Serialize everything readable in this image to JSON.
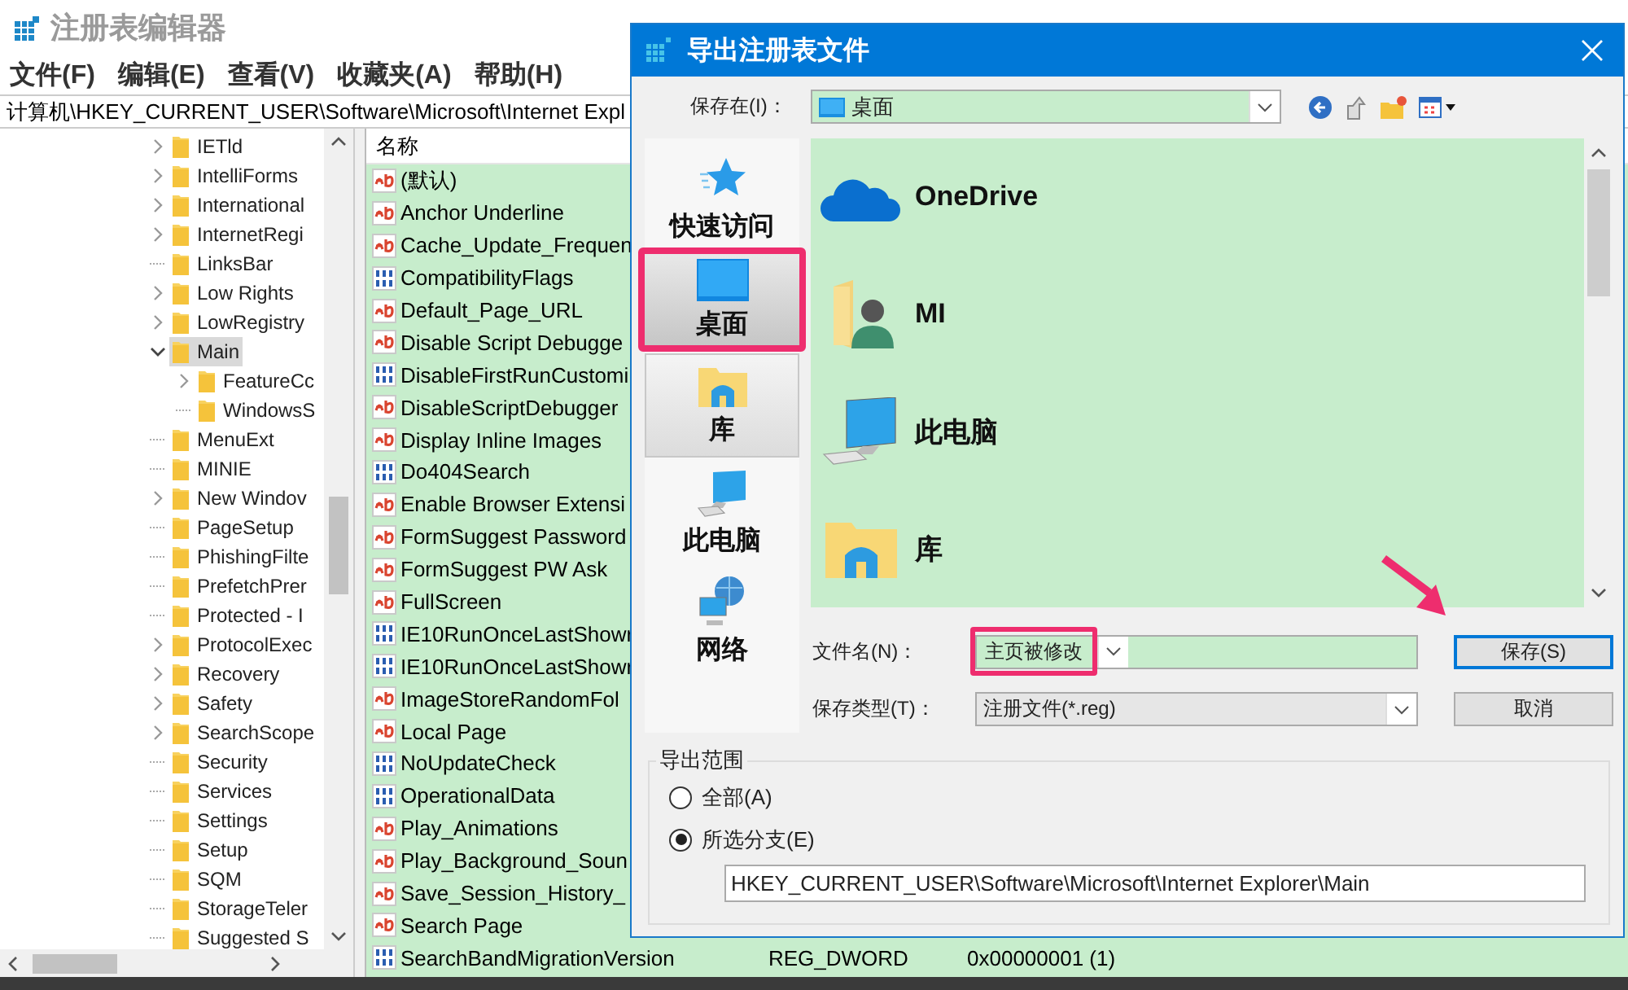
{
  "registry_window": {
    "title": "注册表编辑器",
    "menu": [
      "文件(F)",
      "编辑(E)",
      "查看(V)",
      "收藏夹(A)",
      "帮助(H)"
    ],
    "address": "计算机\\HKEY_CURRENT_USER\\Software\\Microsoft\\Internet Expl",
    "tree": [
      {
        "label": "IETld",
        "expanded": false,
        "selected": false
      },
      {
        "label": "IntelliForms",
        "expanded": false,
        "selected": false
      },
      {
        "label": "International",
        "expanded": false,
        "selected": false
      },
      {
        "label": "InternetRegi",
        "expanded": false,
        "selected": false
      },
      {
        "label": "LinksBar",
        "selected": false
      },
      {
        "label": "Low Rights",
        "expanded": false,
        "selected": false
      },
      {
        "label": "LowRegistry",
        "expanded": false,
        "selected": false
      },
      {
        "label": "Main",
        "expanded": true,
        "selected": true,
        "children": [
          {
            "label": "FeatureCc",
            "expanded": false,
            "selected": false
          },
          {
            "label": "WindowsS",
            "selected": false
          }
        ]
      },
      {
        "label": "MenuExt",
        "selected": false
      },
      {
        "label": "MINIE",
        "selected": false
      },
      {
        "label": "New Windov",
        "expanded": false,
        "selected": false
      },
      {
        "label": "PageSetup",
        "selected": false
      },
      {
        "label": "PhishingFilte",
        "selected": false
      },
      {
        "label": "PrefetchPrer",
        "selected": false
      },
      {
        "label": "Protected - I",
        "selected": false
      },
      {
        "label": "ProtocolExec",
        "expanded": false,
        "selected": false
      },
      {
        "label": "Recovery",
        "expanded": false,
        "selected": false
      },
      {
        "label": "Safety",
        "expanded": false,
        "selected": false
      },
      {
        "label": "SearchScope",
        "expanded": false,
        "selected": false
      },
      {
        "label": "Security",
        "selected": false
      },
      {
        "label": "Services",
        "selected": false
      },
      {
        "label": "Settings",
        "selected": false
      },
      {
        "label": "Setup",
        "selected": false
      },
      {
        "label": "SQM",
        "selected": false
      },
      {
        "label": "StorageTeler",
        "selected": false
      },
      {
        "label": "Suggested S",
        "selected": false
      }
    ],
    "list": {
      "columns": [
        "名称"
      ],
      "rows": [
        {
          "name": "(默认)",
          "kind": "string"
        },
        {
          "name": "Anchor Underline",
          "kind": "string"
        },
        {
          "name": "Cache_Update_Frequen",
          "kind": "string"
        },
        {
          "name": "CompatibilityFlags",
          "kind": "binary"
        },
        {
          "name": "Default_Page_URL",
          "kind": "string"
        },
        {
          "name": "Disable Script Debugge",
          "kind": "string"
        },
        {
          "name": "DisableFirstRunCustomi",
          "kind": "binary"
        },
        {
          "name": "DisableScriptDebugger",
          "kind": "string"
        },
        {
          "name": "Display Inline Images",
          "kind": "string"
        },
        {
          "name": "Do404Search",
          "kind": "binary"
        },
        {
          "name": "Enable Browser Extensi",
          "kind": "string"
        },
        {
          "name": "FormSuggest Password",
          "kind": "string"
        },
        {
          "name": "FormSuggest PW Ask",
          "kind": "string"
        },
        {
          "name": "FullScreen",
          "kind": "string"
        },
        {
          "name": "IE10RunOnceLastShowr",
          "kind": "binary"
        },
        {
          "name": "IE10RunOnceLastShowr",
          "kind": "binary"
        },
        {
          "name": "ImageStoreRandomFol",
          "kind": "string"
        },
        {
          "name": "Local Page",
          "kind": "string"
        },
        {
          "name": "NoUpdateCheck",
          "kind": "binary"
        },
        {
          "name": "OperationalData",
          "kind": "binary"
        },
        {
          "name": "Play_Animations",
          "kind": "string"
        },
        {
          "name": "Play_Background_Soun",
          "kind": "string"
        },
        {
          "name": "Save_Session_History_",
          "kind": "string"
        },
        {
          "name": "Search Page",
          "kind": "string"
        },
        {
          "name": "SearchBandMigrationVersion",
          "kind": "binary",
          "type": "REG_DWORD",
          "data": "0x00000001 (1)"
        }
      ]
    }
  },
  "dialog": {
    "title": "导出注册表文件",
    "save_in": {
      "label": "保存在(I)：",
      "value": "桌面"
    },
    "places": [
      {
        "label": "快速访问",
        "kind": "star",
        "selected": false,
        "hovered": false,
        "highlighted": false
      },
      {
        "label": "桌面",
        "kind": "desktop",
        "selected": true,
        "hovered": false,
        "highlighted": true
      },
      {
        "label": "库",
        "kind": "library",
        "selected": false,
        "hovered": true,
        "highlighted": false
      },
      {
        "label": "此电脑",
        "kind": "computer",
        "selected": false,
        "hovered": false,
        "highlighted": false
      },
      {
        "label": "网络",
        "kind": "network",
        "selected": false,
        "hovered": false,
        "highlighted": false
      }
    ],
    "files": [
      {
        "name": "OneDrive",
        "kind": "cloud"
      },
      {
        "name": "MI",
        "kind": "user"
      },
      {
        "name": "此电脑",
        "kind": "computer"
      },
      {
        "name": "库",
        "kind": "library"
      }
    ],
    "file_name": {
      "label": "文件名(N)：",
      "value": "主页被修改",
      "highlighted": true
    },
    "file_type": {
      "label": "保存类型(T)：",
      "value": "注册文件(*.reg)"
    },
    "buttons": [
      {
        "label": "保存(S)",
        "default": true
      },
      {
        "label": "取消",
        "default": false
      }
    ],
    "export_range": {
      "title": "导出范围",
      "options": [
        {
          "label": "全部(A)",
          "selected": false
        },
        {
          "label": "所选分支(E)",
          "selected": true
        }
      ],
      "branch": "HKEY_CURRENT_USER\\Software\\Microsoft\\Internet Explorer\\Main"
    }
  }
}
